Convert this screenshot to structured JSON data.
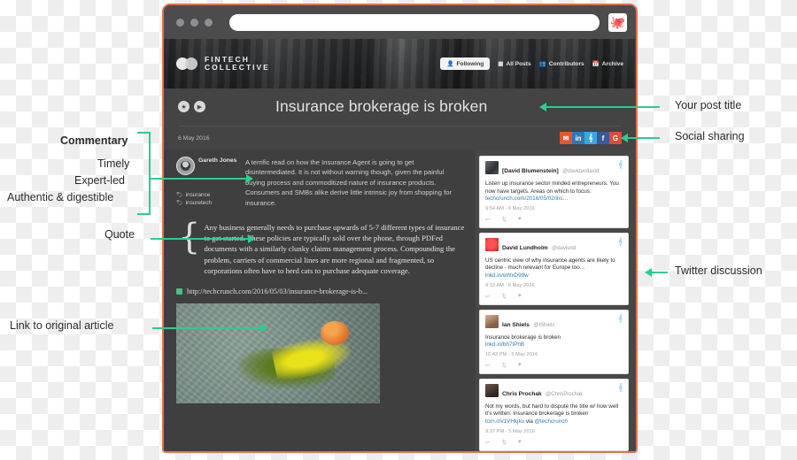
{
  "browser": {
    "url_value": "",
    "url_placeholder": "",
    "octo_icon": "octopus-icon",
    "dots": [
      "close-dot",
      "minimize-dot",
      "maximize-dot"
    ]
  },
  "site_header": {
    "brand_line1": "FINTECH",
    "brand_line2": "COLLECTIVE",
    "nav": [
      {
        "label": "Following",
        "icon": "user-icon",
        "active": true
      },
      {
        "label": "All Posts",
        "icon": "grid-icon",
        "active": false
      },
      {
        "label": "Contributors",
        "icon": "people-icon",
        "active": false
      },
      {
        "label": "Archive",
        "icon": "calendar-icon",
        "active": false
      }
    ]
  },
  "post": {
    "title": "Insurance brokerage is broken",
    "date": "6 May 2016",
    "badges": [
      {
        "icon": "star-icon",
        "glyph": "★"
      },
      {
        "icon": "video-icon",
        "glyph": "▶"
      }
    ],
    "share": [
      {
        "name": "email-share",
        "glyph": "✉",
        "color": "#e8552d"
      },
      {
        "name": "linkedin-share",
        "glyph": "in",
        "color": "#3079b0"
      },
      {
        "name": "twitter-share",
        "glyph": "ᵛ",
        "color": "#38a8e0"
      },
      {
        "name": "facebook-share",
        "glyph": "f",
        "color": "#3b5998"
      },
      {
        "name": "googleplus-share",
        "glyph": "G",
        "color": "#dd4b39"
      }
    ],
    "author": "Gareth Jones",
    "tags": [
      "insurance",
      "insuretech"
    ],
    "commentary": "A terrific read on how the Insurance Agent is going to get disintermediated. It is not without warning though, given the painful buying process and commoditized nature of insurance products. Consumers and SMBs alike derive little intrinsic joy from shopping for insurance.",
    "quote": "Any business generally needs to purchase upwards of 5-7 different types of insurance to get started. These policies are typically sold over the phone, through PDFed documents with a similarly clunky claims management process. Compounding the problem, carriers of commercial lines are more regional and fragmented, so corporations often have to herd cats to purchase adequate coverage.",
    "article_link": "http://techcrunch.com/2016/05/03/insurance-brokerage-is-b...",
    "photo_alt": "broken-egg-on-pavement-photo"
  },
  "twitter": {
    "tweets": [
      {
        "name": "[David Blumenstein]",
        "handle": "@davidavdavid",
        "text": "Listen up insurance sector minded entrepreneurs. You now have targets. Areas on which to focus:",
        "link": "techcrunch.com/2016/05/02/ins…",
        "time": "9:54 AM - 6 May 2016",
        "avatar": "a1"
      },
      {
        "name": "David Lundholm",
        "handle": "@davlund",
        "text": "US centric view of why insurance agents are likely to decline - much relevant for Europe too…",
        "link": "lnkd.in/eWxD99w",
        "time": "9:33 AM - 6 May 2016",
        "avatar": "a2"
      },
      {
        "name": "Ian Shiels",
        "handle": "@IShiels",
        "text": "Insurance brokerage is broken",
        "link": "lnkd.in/bh7tPhB",
        "time": "10:43 PM - 5 May 2016",
        "avatar": "a3"
      },
      {
        "name": "Chris Prochak",
        "handle": "@ChrisProchak",
        "text": "Not my words, but hard to dispute the title w/ how well it's written: Insurance brokerage is broken",
        "link": "tcrn.ch/1VHkjku",
        "link2": "@techcrunch",
        "text2": " via ",
        "time": "9:37 PM - 5 May 2016",
        "avatar": "a4"
      }
    ],
    "actions": [
      "reply-icon",
      "retweet-icon",
      "like-icon"
    ]
  },
  "annotations": {
    "accent_color": "#2ecc8f",
    "commentary": "Commentary",
    "commentary_sub1": "Timely",
    "commentary_sub2": "Expert-led",
    "commentary_sub3": "Authentic & digestible",
    "quote": "Quote",
    "link": "Link to original article",
    "post_title": "Your post title",
    "social": "Social sharing",
    "twitter": "Twitter discussion"
  }
}
